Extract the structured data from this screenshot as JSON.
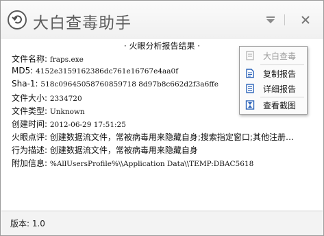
{
  "window": {
    "title": "大白查毒助手",
    "icons": {
      "back": "back-arrow-icon",
      "menu": "dropdown-menu-icon",
      "close": "close-icon"
    }
  },
  "report": {
    "heading": "· 火眼分析报告结果 ·",
    "fields": [
      {
        "label": "文件名称:",
        "value": "fraps.exe"
      },
      {
        "label": "MD5:",
        "value": "4152e3159162386dc761e16767e4aa0f"
      },
      {
        "label": "Sha-1:",
        "value": "518c09645058760859718 8d97b8c662d2f3a6ffe"
      },
      {
        "label": "文件大小:",
        "value": "2334720"
      },
      {
        "label": "文件类型:",
        "value": "Unknown"
      },
      {
        "label": "创建时间:",
        "value": "2012-06-29 17:51:25"
      },
      {
        "label": "火眼点评:",
        "value": "创建数据流文件，常被病毒用来隐藏自身;搜索指定窗口;其他注册…"
      },
      {
        "label": "行为描述:",
        "value": "创建数据流文件，常被病毒用来隐藏自身"
      },
      {
        "label": "附加信息:",
        "value": "%AllUsersProfile%\\\\Application Data\\\\TEMP:DBAC5618"
      }
    ]
  },
  "popup_menu": {
    "items": [
      {
        "label": "大白查毒",
        "icon": "scan-icon",
        "disabled": true
      },
      {
        "label": "复制报告",
        "icon": "copy-document-icon",
        "disabled": false
      },
      {
        "label": "详细报告",
        "icon": "detail-report-icon",
        "disabled": false
      },
      {
        "label": "查看截图",
        "icon": "screenshot-icon",
        "disabled": false
      }
    ]
  },
  "footer": {
    "version": "版本: 1.0"
  },
  "colors": {
    "title_text": "#5c5c5c",
    "accent_blue": "#2a62b8",
    "disabled_text": "#9a9a9a"
  }
}
